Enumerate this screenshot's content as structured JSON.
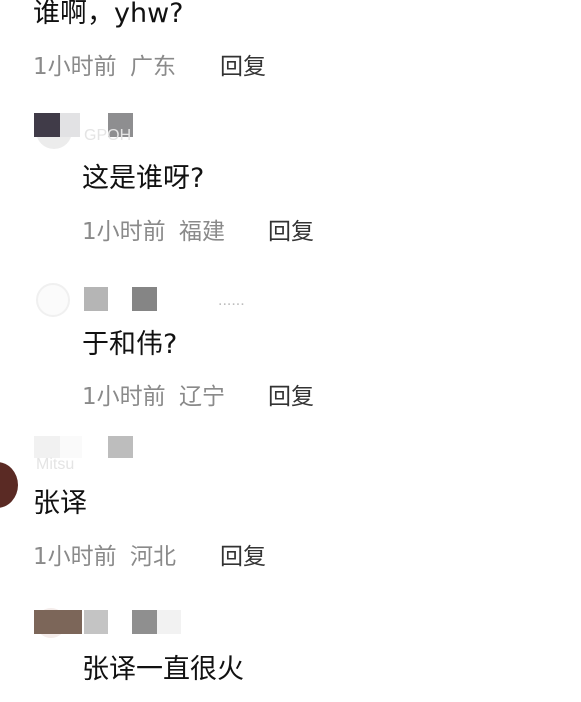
{
  "comments": [
    {
      "content": "谁啊，yhw?",
      "time": "1小时前",
      "location": "广东",
      "reply_label": "回复"
    },
    {
      "content": "这是谁呀?",
      "time": "1小时前",
      "location": "福建",
      "reply_label": "回复"
    },
    {
      "content": "于和伟?",
      "time": "1小时前",
      "location": "辽宁",
      "reply_label": "回复"
    },
    {
      "content": "张译",
      "time": "1小时前",
      "location": "河北",
      "reply_label": "回复"
    },
    {
      "content": "张译一直很火"
    }
  ],
  "username_fragments": {
    "comment_2": "GPOH",
    "comment_3": "......",
    "comment_4": "Mitsu"
  },
  "colors": {
    "content_text": "#111111",
    "meta_text": "#8a8a8a",
    "reply_text": "#333333"
  }
}
